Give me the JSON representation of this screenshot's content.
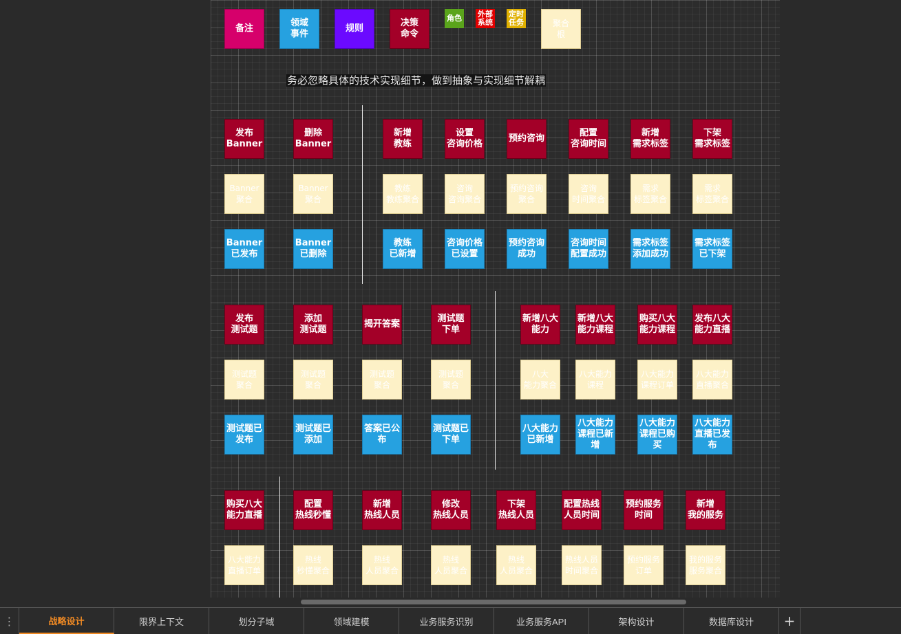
{
  "legend": {
    "remark": "备注",
    "domain_event": "领域\n事件",
    "rule": "规则",
    "decision_command": "决策\n命令",
    "role": "角色",
    "external_system": "外部\n系统",
    "scheduled_task": "定时\n任务",
    "aggregate": "聚合\n根"
  },
  "caption": "务必忽略具体的技术实现细节，做到抽象与实现细节解耦",
  "rows": {
    "r1_commands": [
      "发布\nBanner",
      "删除\nBanner",
      "新增\n教练",
      "设置\n咨询价格",
      "预约咨询",
      "配置\n咨询时间",
      "新增\n需求标签",
      "下架\n需求标签"
    ],
    "r1_aggregates": [
      "Banner\n聚合",
      "Banner\n聚合",
      "教练\n教练聚合",
      "咨询\n咨询聚合",
      "预约咨询\n聚合",
      "咨询\n时间聚合",
      "需求\n标签聚合",
      "需求\n标签聚合"
    ],
    "r1_events": [
      "Banner\n已发布",
      "Banner\n已删除",
      "教练\n已新增",
      "咨询价格\n已设置",
      "预约咨询\n成功",
      "咨询时间\n配置成功",
      "需求标签\n添加成功",
      "需求标签\n已下架"
    ],
    "r2_commands": [
      "发布\n测试题",
      "添加\n测试题",
      "揭开答案",
      "测试题\n下单",
      "新增八大\n能力",
      "新增八大\n能力课程",
      "购买八大\n能力课程",
      "发布八大\n能力直播"
    ],
    "r2_aggregates": [
      "测试题\n聚合",
      "测试题\n聚合",
      "测试题\n聚合",
      "测试题\n聚合",
      "八大\n能力聚合",
      "八大能力\n课程",
      "八大能力\n课程订单",
      "八大能力\n直播聚合"
    ],
    "r2_events": [
      "测试题已\n发布",
      "测试题已\n添加",
      "答案已公\n布",
      "测试题已\n下单",
      "八大能力\n已新增",
      "八大能力\n课程已新\n增",
      "八大能力\n课程已购\n买",
      "八大能力\n直播已发\n布"
    ],
    "r3_commands": [
      "购买八大\n能力直播",
      "配置\n热线秒懂",
      "新增\n热线人员",
      "修改\n热线人员",
      "下架\n热线人员",
      "配置热线\n人员时间",
      "预约服务\n时间",
      "新增\n我的服务"
    ],
    "r3_aggregates": [
      "八大能力\n直播订单",
      "热线\n秒懂聚合",
      "热线\n人员聚合",
      "热线\n人员聚合",
      "热线\n人员聚合",
      "热线人员\n时间聚合",
      "预约服务\n订单",
      "我的服务\n服务聚合"
    ]
  },
  "tabs": [
    "战略设计",
    "限界上下文",
    "划分子域",
    "领域建模",
    "业务服务识别",
    "业务服务API",
    "架构设计",
    "数据库设计"
  ],
  "active_tab": "战略设计",
  "tab_add_label": "+",
  "tab_handle_label": "⋮"
}
